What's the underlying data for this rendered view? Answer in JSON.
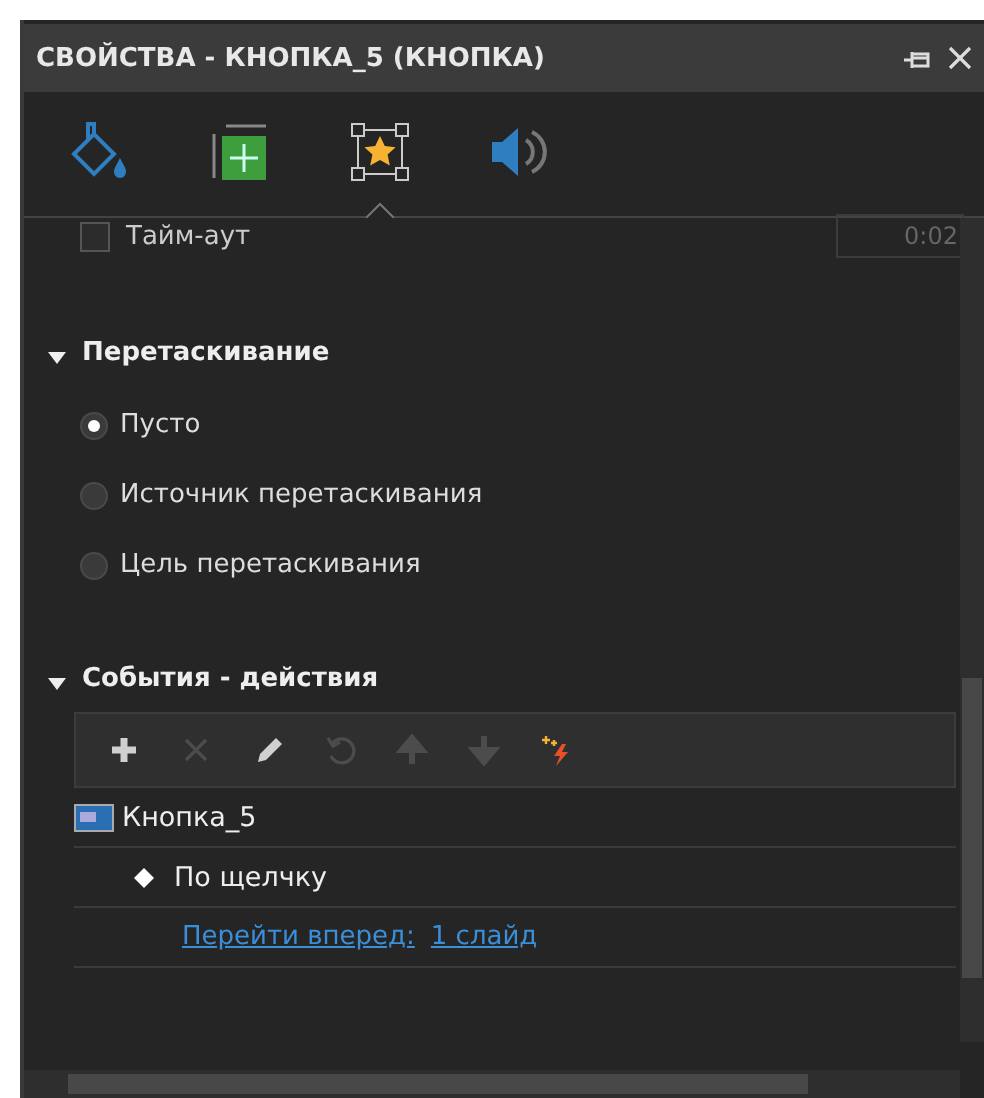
{
  "window": {
    "title": "СВОЙСТВА - КНОПКА_5 (КНОПКА)"
  },
  "tabs": [
    {
      "kind": "fill",
      "selected": false
    },
    {
      "kind": "size",
      "selected": false
    },
    {
      "kind": "actions",
      "selected": true
    },
    {
      "kind": "sound",
      "selected": false
    }
  ],
  "timeout": {
    "label": "Тайм-аут",
    "checked": false,
    "value": "0:02"
  },
  "sections": [
    {
      "title": "Перетаскивание",
      "expanded": true,
      "options": [
        {
          "label": "Пусто",
          "selected": true
        },
        {
          "label": "Источник перетаскивания",
          "selected": false
        },
        {
          "label": "Цель перетаскивания",
          "selected": false
        }
      ]
    },
    {
      "title": "События - действия",
      "expanded": true
    }
  ],
  "toolbar": [
    {
      "kind": "add",
      "disabled": false
    },
    {
      "kind": "delete",
      "disabled": true
    },
    {
      "kind": "edit",
      "disabled": false
    },
    {
      "kind": "undo",
      "disabled": true
    },
    {
      "kind": "up",
      "disabled": true
    },
    {
      "kind": "down",
      "disabled": true
    },
    {
      "kind": "effects",
      "disabled": false
    }
  ],
  "events": [
    {
      "label": "Кнопка_5",
      "children": [
        {
          "label": "По щелчку",
          "children": [
            {
              "links": [
                "Перейти вперед:",
                "1 слайд"
              ]
            }
          ]
        }
      ]
    }
  ]
}
